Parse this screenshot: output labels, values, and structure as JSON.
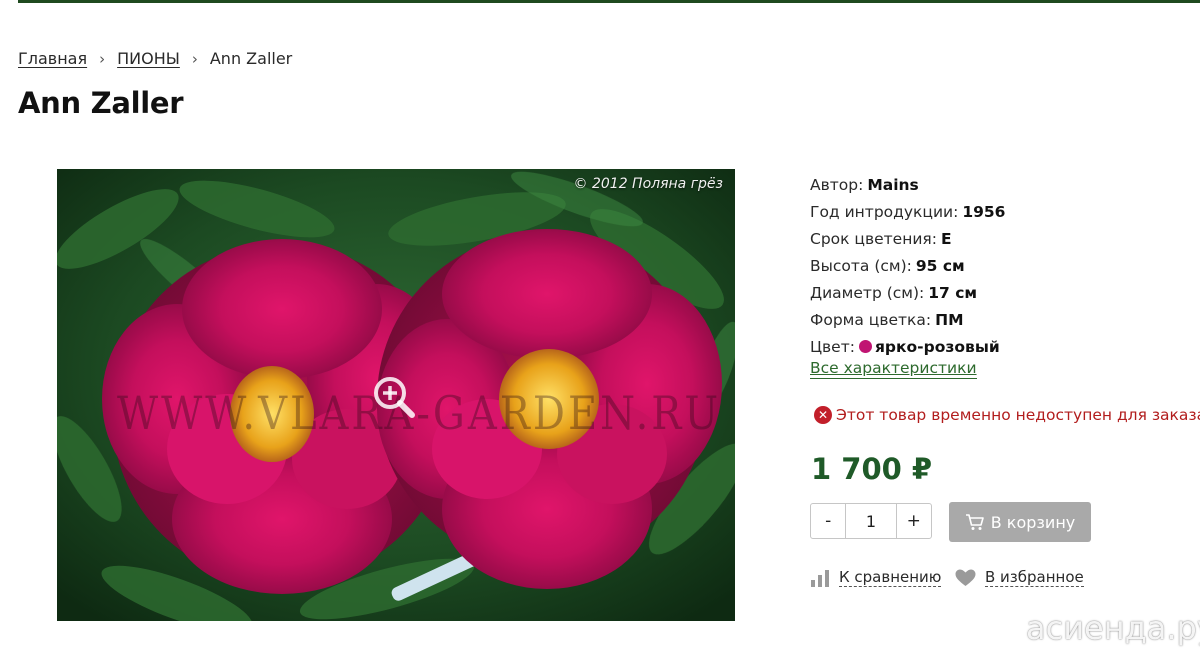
{
  "breadcrumb": {
    "home": "Главная",
    "category": "ПИОНЫ",
    "current": "Ann Zaller"
  },
  "page_title": "Ann Zaller",
  "photo": {
    "copyright": "© 2012 Поляна грёз",
    "watermark": "WWW.VLARA-GARDEN.RU"
  },
  "specs": [
    {
      "key": "Автор:",
      "value": "Mains"
    },
    {
      "key": "Год интродукции:",
      "value": "1956"
    },
    {
      "key": "Срок цветения:",
      "value": "E"
    },
    {
      "key": "Высота (см):",
      "value": "95 см"
    },
    {
      "key": "Диаметр (см):",
      "value": "17 см"
    },
    {
      "key": "Форма цветка:",
      "value": "ПМ"
    }
  ],
  "color_spec": {
    "key": "Цвет:",
    "value": "ярко-розовый",
    "swatch": "#c01472"
  },
  "all_specs_link": "Все характеристики",
  "availability": "Этот товар временно недоступен для заказа",
  "price": "1 700 ₽",
  "quantity": {
    "minus": "-",
    "value": "1",
    "plus": "+"
  },
  "cart_button": "В корзину",
  "compare_link": "К сравнению",
  "favorite_link": "В избранное",
  "site_watermark": "асиенда.ру",
  "colors": {
    "topbar": "#1f4a1f",
    "price": "#1f5a28",
    "link_green": "#2d6a2d",
    "error": "#c21f2a",
    "cart_button": "#a9a9a9"
  }
}
